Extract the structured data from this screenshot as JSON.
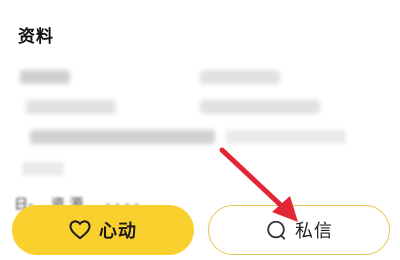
{
  "profile": {
    "section_title": "资料",
    "partial_text": "日-  ...资  源  ...  -  -  -  -  ..."
  },
  "actions": {
    "like_label": "心动",
    "like_icon": "heart-outline-icon",
    "message_label": "私信",
    "message_icon": "chat-bubble-icon"
  },
  "colors": {
    "accent_yellow": "#f9d02e",
    "message_border": "#e6c85a",
    "annotation_arrow": "#e32636"
  }
}
